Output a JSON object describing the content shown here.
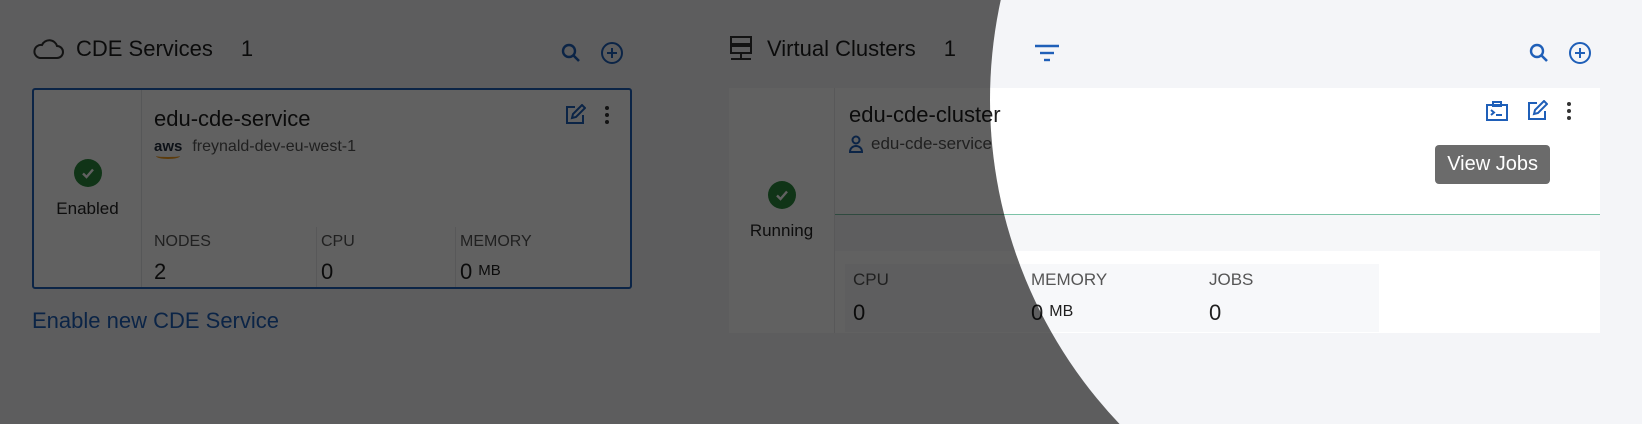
{
  "cde_services": {
    "title": "CDE Services",
    "count": "1",
    "card": {
      "status": "Enabled",
      "name": "edu-cde-service",
      "cloud_logo": "aws",
      "environment": "freynald-dev-eu-west-1",
      "metrics": [
        {
          "label": "NODES",
          "value": "2",
          "unit": ""
        },
        {
          "label": "CPU",
          "value": "0",
          "unit": ""
        },
        {
          "label": "MEMORY",
          "value": "0",
          "unit": "MB"
        }
      ]
    },
    "enable_link": "Enable new CDE Service"
  },
  "virtual_clusters": {
    "title": "Virtual Clusters",
    "count": "1",
    "card": {
      "status": "Running",
      "name": "edu-cde-cluster",
      "service": "edu-cde-service",
      "tooltip": "View Jobs",
      "metrics": [
        {
          "label": "CPU",
          "value": "0",
          "unit": ""
        },
        {
          "label": "MEMORY",
          "value": "0",
          "unit": "MB"
        },
        {
          "label": "JOBS",
          "value": "0",
          "unit": ""
        }
      ]
    }
  },
  "colors": {
    "accent": "#1f5fb8",
    "success": "#2a8a3e",
    "overlay": "#000000"
  },
  "icons": [
    "cloud-icon",
    "search-icon",
    "add-circle-icon",
    "server-icon",
    "filter-icon",
    "edit-icon",
    "more-vert-icon",
    "view-jobs-icon",
    "service-icon",
    "check-icon"
  ]
}
